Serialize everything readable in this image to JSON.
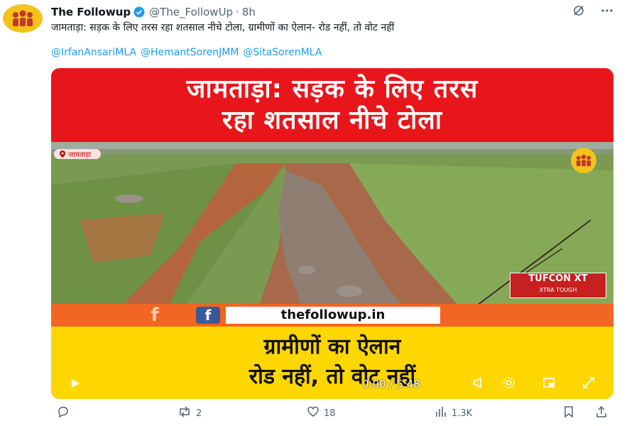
{
  "tweet": {
    "author": "The Followup",
    "handle": "@The_FollowUp",
    "separator": "·",
    "time": "8h",
    "text": "जामताड़ा: सड़क के लिए तरस रहा शतसाल नीचे टोला, ग्रामीणों का ऐलान- रोड नहीं, तो वोट नहीं",
    "mentions": [
      "@IrfanAnsariMLA",
      "@HemantSorenJMM",
      "@SitaSorenMLA"
    ]
  },
  "media": {
    "headline_line1": "जामताड़ा: सड़क के लिए तरस",
    "headline_line2": "रहा शतसाल नीचे टोला",
    "location_tag": "जामताड़ा",
    "overlay_brand": "TUFCON XT",
    "overlay_brand_tagline": "XTRA TOUGH",
    "fb_letter": "f",
    "site": "thefollowup.in",
    "bottom_line1": "ग्रामीणों का ऐलान",
    "bottom_line2": "रोड नहीं, तो वोट नहीं",
    "timecode": "0:00 / 5:48"
  },
  "actions": {
    "retweets": "2",
    "likes": "18",
    "views": "1.3K"
  },
  "colors": {
    "banner_red": "#e8161a",
    "yellow": "#ffd700",
    "link_blue": "#1d9bf0",
    "verified_blue": "#1d9bf0",
    "avatar_yellow": "#f4c21a"
  },
  "icons": {
    "verified": "verified-badge-icon",
    "grok": "grok-icon",
    "more": "more-icon",
    "play": "play-icon",
    "reply": "reply-icon",
    "retweet": "retweet-icon",
    "like": "heart-icon",
    "views": "views-icon",
    "bookmark": "bookmark-icon",
    "share": "share-icon"
  }
}
